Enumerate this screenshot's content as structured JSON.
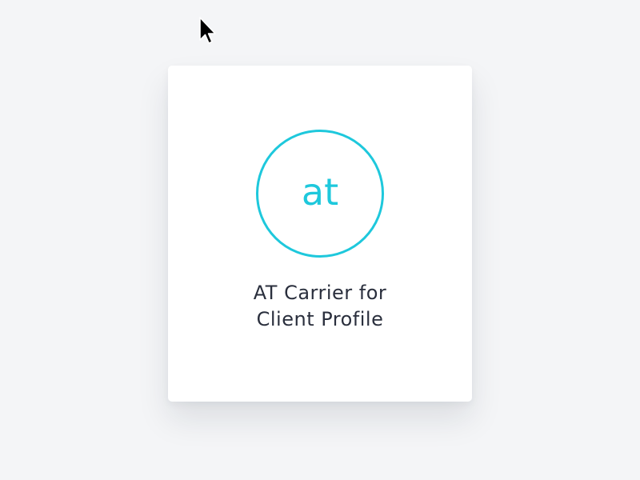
{
  "card": {
    "avatar_text": "at",
    "title_line1": "AT Carrier for",
    "title_line2": "Client Profile"
  },
  "colors": {
    "accent": "#1ec8dc",
    "background": "#f4f5f7",
    "card": "#ffffff",
    "text": "#2a2f3d"
  },
  "icons": {
    "pointer": "mouse-pointer-icon"
  }
}
